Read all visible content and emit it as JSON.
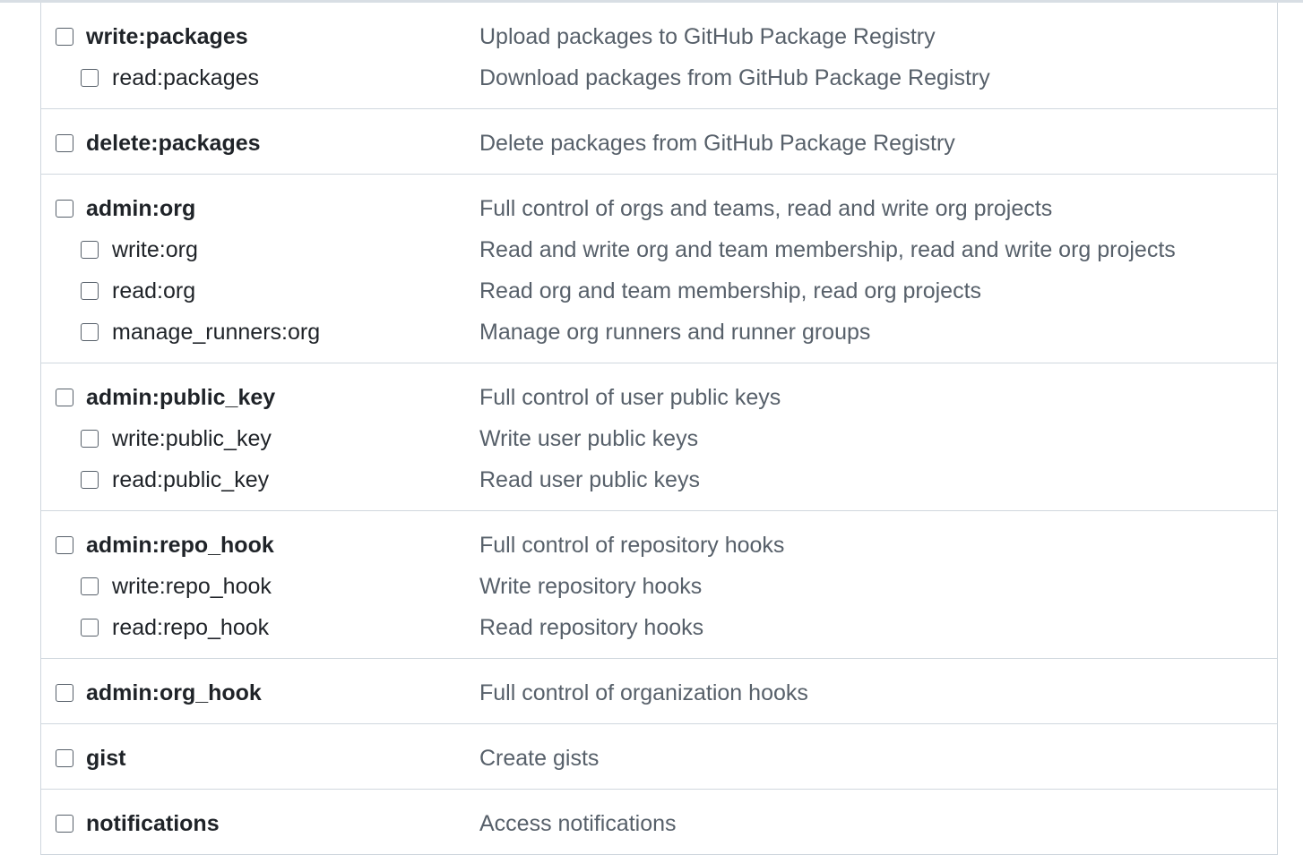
{
  "groups": [
    {
      "id": "packages",
      "rows": [
        {
          "name": "write:packages",
          "desc": "Upload packages to GitHub Package Registry",
          "level": "parent",
          "checked": false
        },
        {
          "name": "read:packages",
          "desc": "Download packages from GitHub Package Registry",
          "level": "child",
          "checked": false
        }
      ]
    },
    {
      "id": "delete-packages",
      "rows": [
        {
          "name": "delete:packages",
          "desc": "Delete packages from GitHub Package Registry",
          "level": "parent",
          "checked": false
        }
      ]
    },
    {
      "id": "org",
      "rows": [
        {
          "name": "admin:org",
          "desc": "Full control of orgs and teams, read and write org projects",
          "level": "parent",
          "checked": false
        },
        {
          "name": "write:org",
          "desc": "Read and write org and team membership, read and write org projects",
          "level": "child",
          "checked": false
        },
        {
          "name": "read:org",
          "desc": "Read org and team membership, read org projects",
          "level": "child",
          "checked": false
        },
        {
          "name": "manage_runners:org",
          "desc": "Manage org runners and runner groups",
          "level": "child",
          "checked": false
        }
      ]
    },
    {
      "id": "public-key",
      "rows": [
        {
          "name": "admin:public_key",
          "desc": "Full control of user public keys",
          "level": "parent",
          "checked": false
        },
        {
          "name": "write:public_key",
          "desc": "Write user public keys",
          "level": "child",
          "checked": false
        },
        {
          "name": "read:public_key",
          "desc": "Read user public keys",
          "level": "child",
          "checked": false
        }
      ]
    },
    {
      "id": "repo-hook",
      "rows": [
        {
          "name": "admin:repo_hook",
          "desc": "Full control of repository hooks",
          "level": "parent",
          "checked": false
        },
        {
          "name": "write:repo_hook",
          "desc": "Write repository hooks",
          "level": "child",
          "checked": false
        },
        {
          "name": "read:repo_hook",
          "desc": "Read repository hooks",
          "level": "child",
          "checked": false
        }
      ]
    },
    {
      "id": "org-hook",
      "rows": [
        {
          "name": "admin:org_hook",
          "desc": "Full control of organization hooks",
          "level": "parent",
          "checked": false
        }
      ]
    },
    {
      "id": "gist",
      "rows": [
        {
          "name": "gist",
          "desc": "Create gists",
          "level": "parent",
          "checked": false
        }
      ]
    },
    {
      "id": "notifications",
      "rows": [
        {
          "name": "notifications",
          "desc": "Access notifications",
          "level": "parent",
          "checked": false
        }
      ]
    }
  ]
}
